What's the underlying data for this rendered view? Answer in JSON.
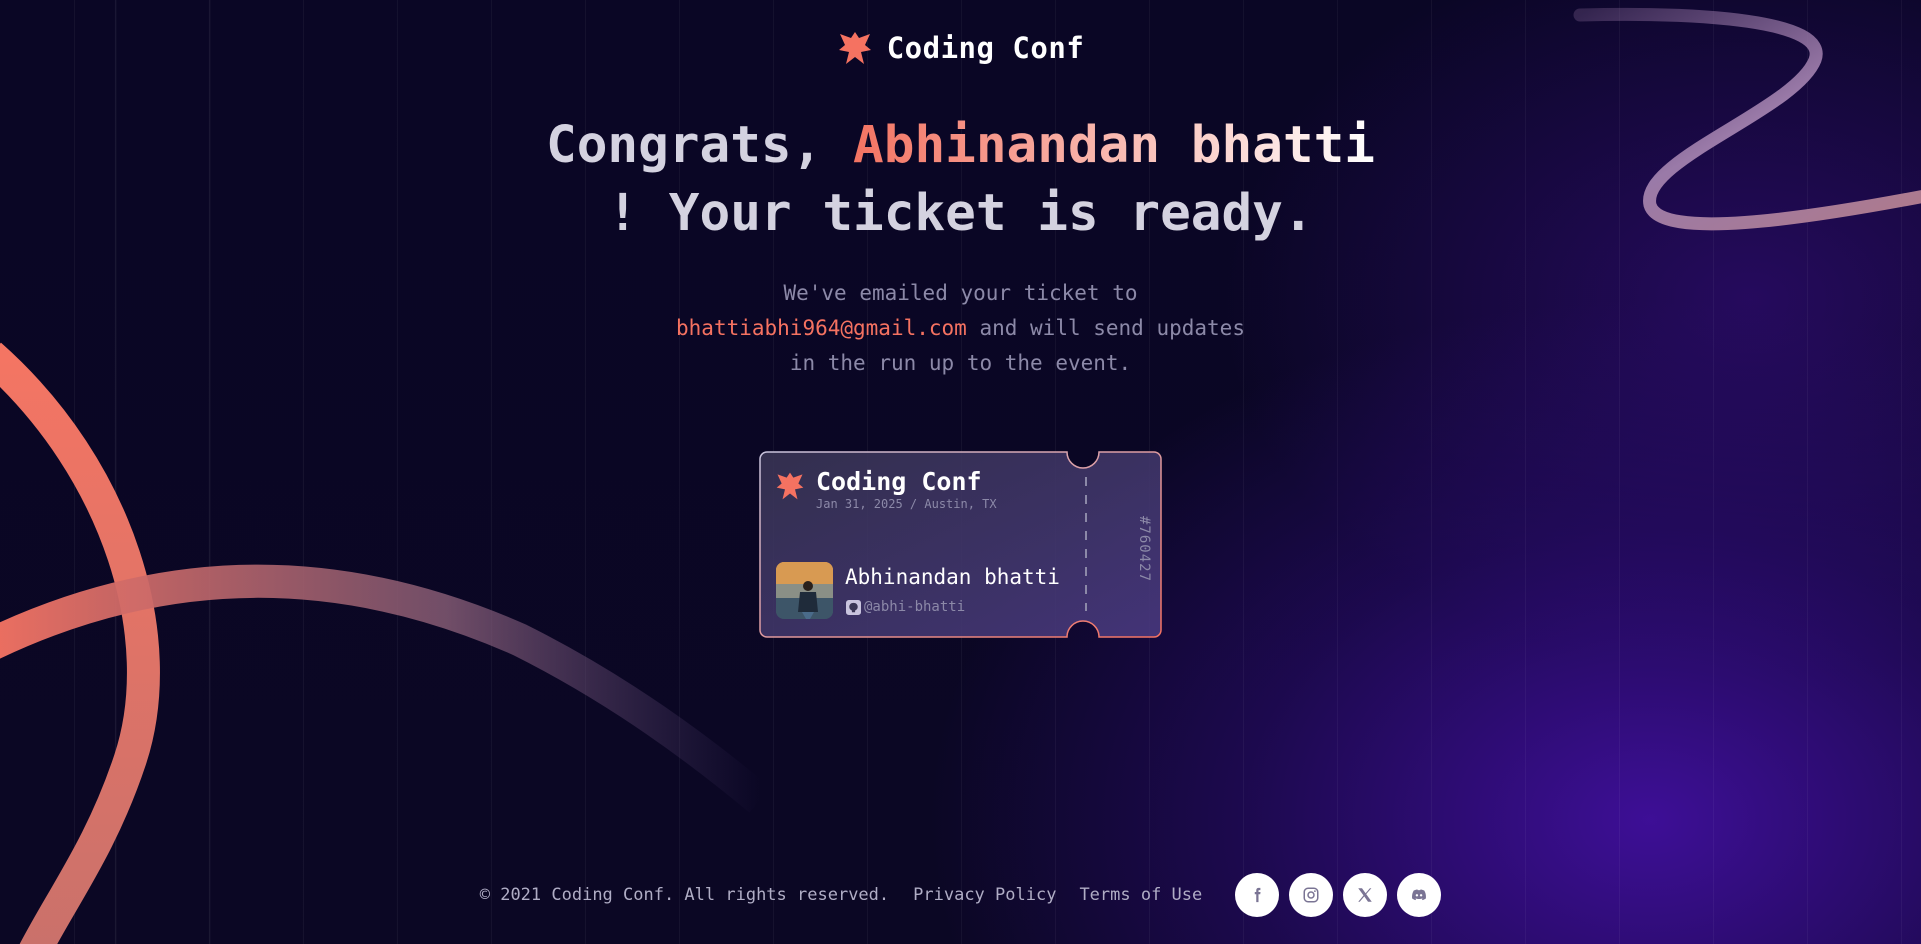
{
  "brand": {
    "name": "Coding Conf",
    "accent": "#f57261"
  },
  "headline": {
    "prefix": "Congrats, ",
    "name": "Abhinandan bhatti",
    "suffix": "! Your ticket is ready."
  },
  "subline": {
    "line1": "We've emailed your ticket to",
    "email": "bhattiabhi964@gmail.com",
    "after_email": " and will send updates",
    "line3": "in the run up to the event."
  },
  "ticket": {
    "title": "Coding Conf",
    "date_location": "Jan 31, 2025 / Austin, TX",
    "attendee_name": "Abhinandan bhatti",
    "github_handle": "@abhi-bhatti",
    "ticket_number": "#760427"
  },
  "footer": {
    "copyright": "© 2021 Coding Conf. All rights reserved.",
    "privacy": "Privacy Policy",
    "terms": "Terms of Use",
    "social_icons": [
      "facebook-icon",
      "instagram-icon",
      "x-icon",
      "discord-icon"
    ]
  }
}
